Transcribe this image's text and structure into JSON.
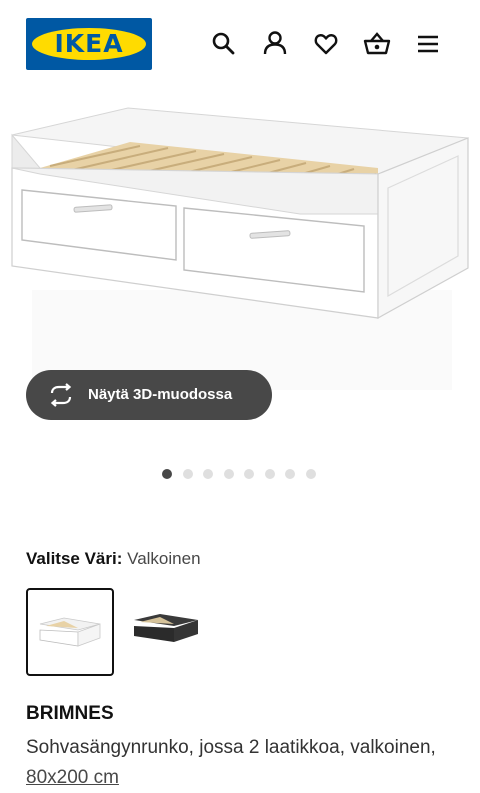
{
  "header": {
    "logo_text": "IKEA",
    "icons": [
      "search-icon",
      "account-icon",
      "heart-icon",
      "basket-icon",
      "menu-icon"
    ]
  },
  "view3d": {
    "label": "Näytä 3D-muodossa",
    "icon": "rotate-3d-icon"
  },
  "gallery": {
    "total_images": 8,
    "active_index": 0
  },
  "color_selector": {
    "label": "Valitse Väri:",
    "selected_value": "Valkoinen",
    "options": [
      {
        "color": "#ffffff",
        "selected": true
      },
      {
        "color": "#2e2e2e",
        "selected": false
      }
    ]
  },
  "product": {
    "name": "BRIMNES",
    "description": "Sohvasängynrunko, jossa 2 laatikkoa, valkoinen,",
    "size_link": "80x200 cm"
  },
  "colors": {
    "brand_blue": "#0058a3",
    "brand_yellow": "#ffdb00",
    "button_dark": "#484848"
  }
}
